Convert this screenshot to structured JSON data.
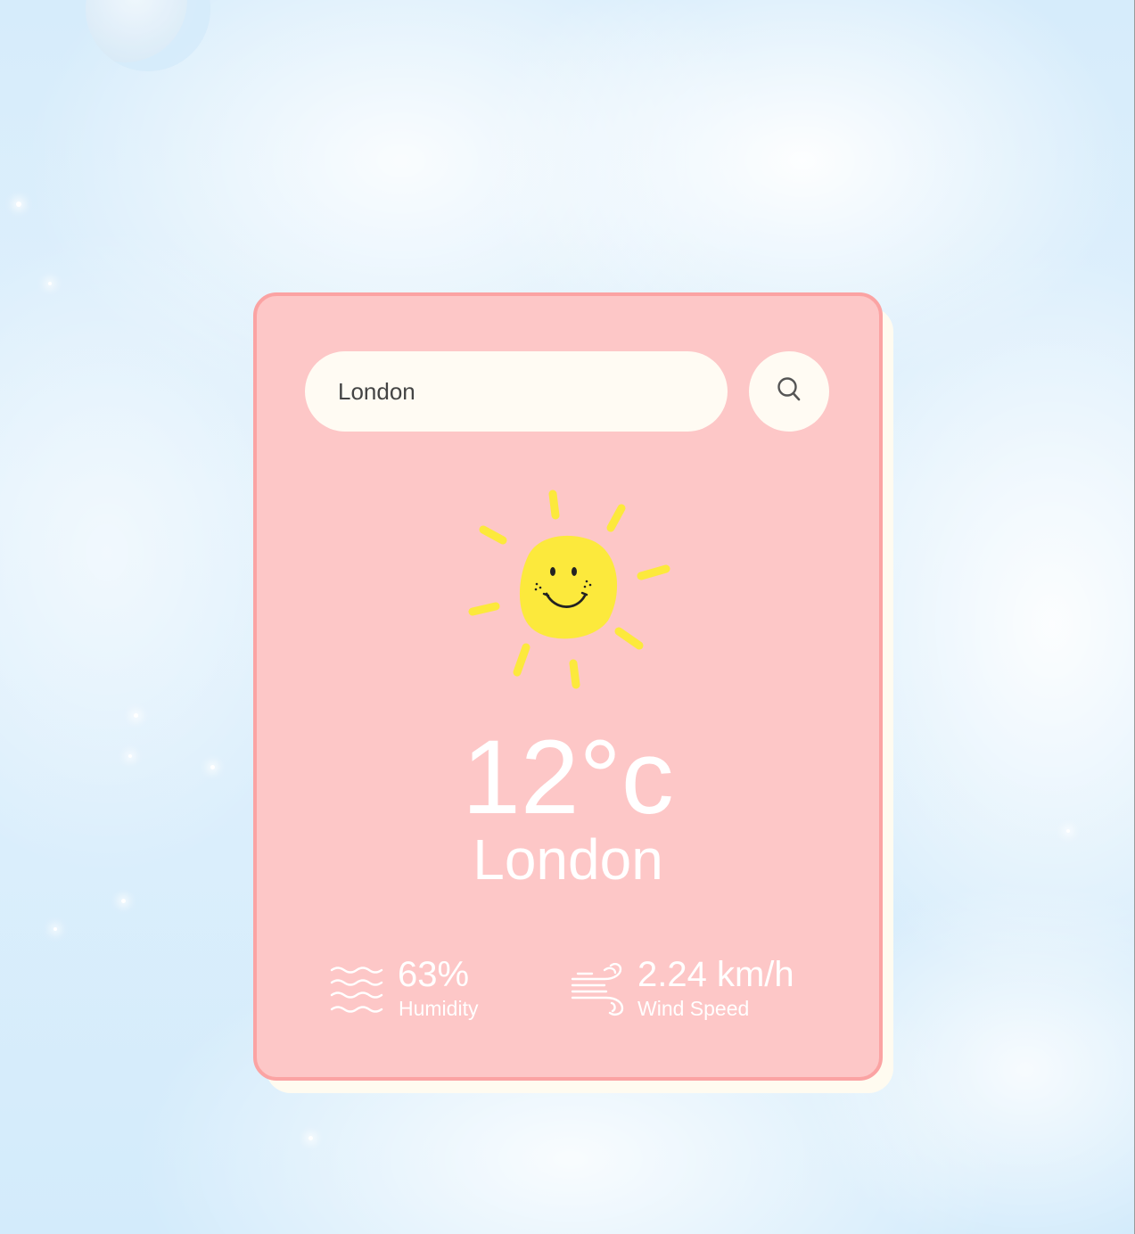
{
  "search": {
    "value": "London",
    "button_icon": "search-icon"
  },
  "weather": {
    "icon": "sun-icon",
    "temperature": "12°c",
    "city": "London"
  },
  "details": {
    "humidity": {
      "icon": "humidity-icon",
      "value": "63%",
      "label": "Humidity"
    },
    "wind": {
      "icon": "wind-icon",
      "value": "2.24 km/h",
      "label": "Wind Speed"
    }
  },
  "colors": {
    "card_background": "#fdc7c7",
    "card_border": "#fba3a3",
    "input_background": "#fffbf3",
    "sun_yellow": "#fce93c",
    "text": "#ffffff"
  }
}
